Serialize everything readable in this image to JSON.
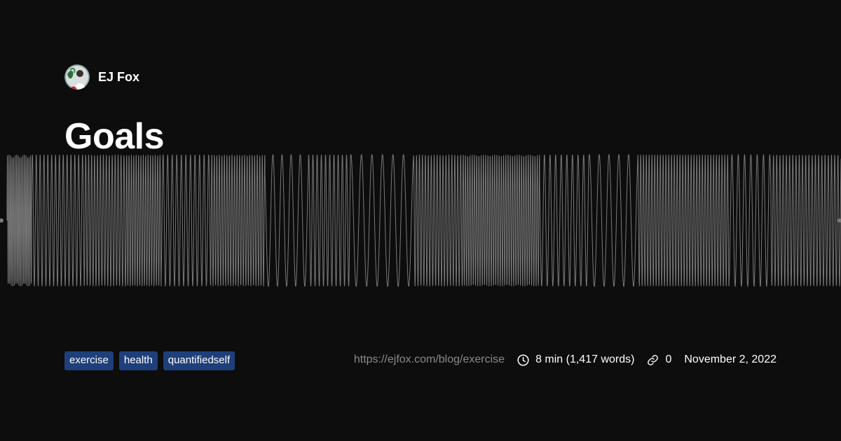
{
  "author": {
    "name": "EJ Fox"
  },
  "post": {
    "title": "Goals",
    "tags": [
      "exercise",
      "health",
      "quantifiedself"
    ],
    "url": "https://ejfox.com/blog/exercise",
    "reading_time": "8 min (1,417 words)",
    "links_count": "0",
    "date": "November 2, 2022"
  },
  "icons": {
    "reading_time": "clock-icon",
    "links": "link-icon"
  },
  "colors": {
    "background": "#0d0d0d",
    "tag_background": "#1e3f7a",
    "url_text": "#8a8a8a",
    "waveform": "#7a7a7a"
  }
}
